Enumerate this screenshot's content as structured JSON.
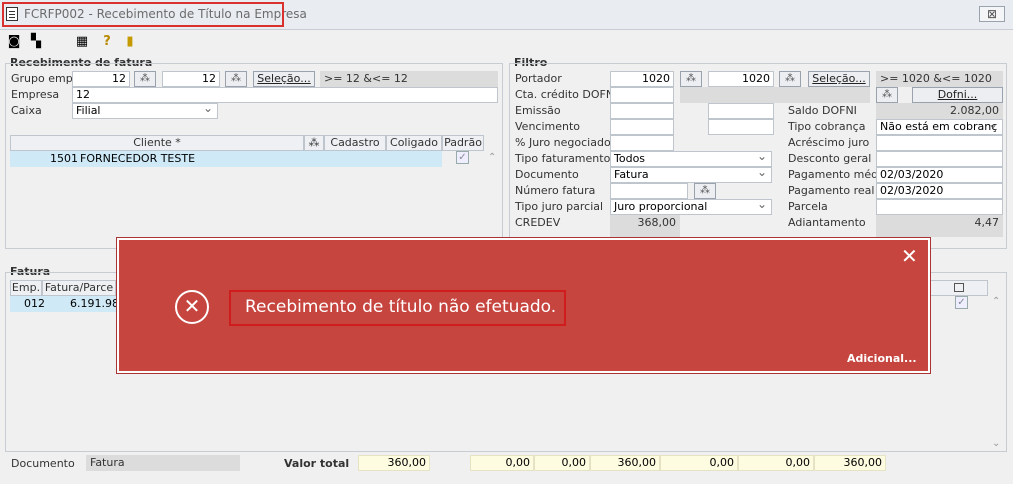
{
  "window": {
    "title": "FCRFP002 - Recebimento de Título na Empresa",
    "close_label": "⊠"
  },
  "toolbar": {
    "icons": [
      "exit-icon",
      "copy-icon",
      "calculator-icon",
      "help-icon",
      "door-icon"
    ]
  },
  "recebimento": {
    "group_title": "Recebimento de fatura",
    "grupo_label": "Grupo emp.",
    "grupo_from": "12",
    "grupo_to": "12",
    "selecao_label": "Seleção...",
    "grupo_range": ">= 12 &<= 12",
    "empresa_label": "Empresa",
    "empresa_value": "12",
    "caixa_label": "Caixa",
    "caixa_value": "Filial",
    "grid_headers": {
      "cliente": "Cliente *",
      "cadastro": "Cadastro",
      "coligado": "Coligado",
      "padrao": "Padrão"
    },
    "row": {
      "code": "1501",
      "name": "FORNECEDOR TESTE"
    }
  },
  "filtro": {
    "group_title": "Filtro",
    "portador_label": "Portador",
    "portador_from": "1020",
    "portador_to": "1020",
    "selecao_label": "Seleção...",
    "portador_range": ">= 1020 &<= 1020",
    "cta_label": "Cta. crédito DOFNI",
    "dofni_label": "Dofni...",
    "emissao_label": "Emissão",
    "vencimento_label": "Vencimento",
    "juro_label": "% Juro negociado",
    "tipo_fat_label": "Tipo faturamento",
    "tipo_fat_value": "Todos",
    "documento_label": "Documento",
    "documento_value": "Fatura",
    "numero_label": "Número fatura",
    "tipo_juro_label": "Tipo juro parcial",
    "tipo_juro_value": "Juro proporcional",
    "credev_label": "CREDEV",
    "credev_value": "368,00",
    "saldo_label": "Saldo DOFNI",
    "saldo_value": "2.082,00",
    "tipo_cob_label": "Tipo cobrança",
    "tipo_cob_value": "Não está em cobranç",
    "acrescimo_label": "Acréscimo juro",
    "desconto_label": "Desconto geral",
    "pag_medio_label": "Pagamento médio",
    "pag_medio_value": "02/03/2020",
    "pag_real_label": "Pagamento real",
    "pag_real_value": "02/03/2020",
    "parcela_label": "Parcela",
    "adiantamento_label": "Adiantamento",
    "adiantamento_value": "4,47"
  },
  "fatura": {
    "group_title": "Fatura",
    "headers": {
      "emp": "Emp.",
      "fatura": "Fatura/Parce"
    },
    "row": {
      "emp": "012",
      "fatura": "6.191.98"
    }
  },
  "footer": {
    "documento_label": "Documento",
    "documento_value": "Fatura",
    "valor_total_label": "Valor total",
    "totals": [
      "360,00",
      "0,00",
      "0,00",
      "360,00",
      "0,00",
      "0,00",
      "360,00"
    ]
  },
  "dialog": {
    "message": "Recebimento de título não efetuado.",
    "close": "✕",
    "adicional": "Adicional...",
    "icon": "error-icon"
  },
  "colors": {
    "dialog_bg": "#c6453f",
    "highlight": "#d9322e",
    "row_highlight": "#cfe9f7",
    "totals_bg": "#fdfbe0"
  }
}
